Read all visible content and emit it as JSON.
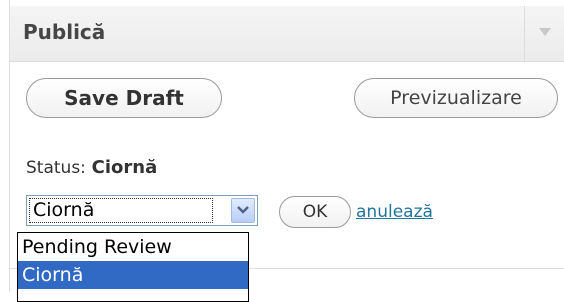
{
  "box": {
    "title": "Publică"
  },
  "buttons": {
    "save_draft": "Save Draft",
    "preview": "Previzualizare"
  },
  "status": {
    "label": "Status:",
    "value": "Ciornă"
  },
  "status_select": {
    "selected": "Ciornă",
    "options": [
      "Pending Review",
      "Ciornă"
    ]
  },
  "actions": {
    "ok": "OK",
    "cancel": "anulează"
  },
  "colors": {
    "link": "#21759b",
    "highlight": "#316ac5"
  }
}
